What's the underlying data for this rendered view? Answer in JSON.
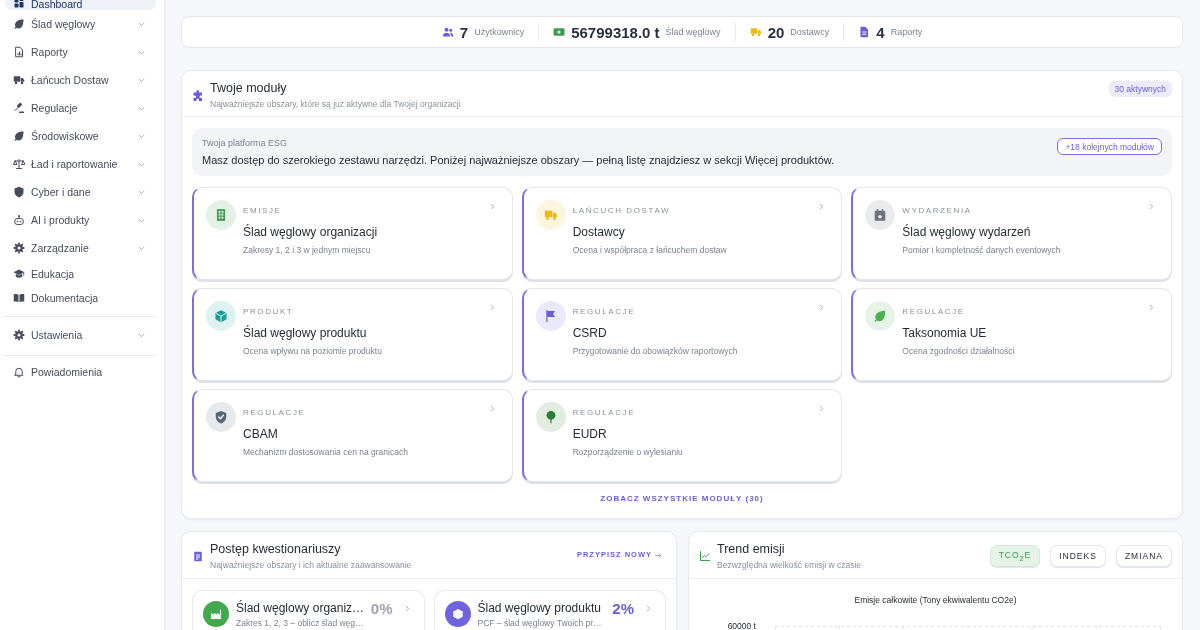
{
  "sidebar": {
    "groups": [
      {
        "items": [
          {
            "label": "Dashboard",
            "selected": true,
            "expandable": false
          },
          {
            "label": "Ślad węglowy",
            "selected": false,
            "expandable": true
          },
          {
            "label": "Raporty",
            "selected": false,
            "expandable": true
          },
          {
            "label": "Łańcuch Dostaw",
            "selected": false,
            "expandable": true
          },
          {
            "label": "Regulacje",
            "selected": false,
            "expandable": true
          },
          {
            "label": "Środowiskowe",
            "selected": false,
            "expandable": true
          },
          {
            "label": "Ład i raportowanie",
            "selected": false,
            "expandable": true
          },
          {
            "label": "Cyber i dane",
            "selected": false,
            "expandable": true
          },
          {
            "label": "AI i produkty",
            "selected": false,
            "expandable": true
          },
          {
            "label": "Zarządzanie",
            "selected": false,
            "expandable": true
          },
          {
            "label": "Edukacja",
            "selected": false,
            "expandable": false
          },
          {
            "label": "Dokumentacja",
            "selected": false,
            "expandable": false
          }
        ]
      },
      {
        "items": [
          {
            "label": "Ustawienia",
            "selected": false,
            "expandable": true
          }
        ]
      },
      {
        "items": [
          {
            "label": "Powiadomienia",
            "selected": false,
            "expandable": false
          }
        ]
      }
    ]
  },
  "stats": [
    {
      "value": "7",
      "label": "Użytkownicy",
      "color": "#6a5fd8"
    },
    {
      "value": "56799318.0 t",
      "label": "Ślad węglowy",
      "color": "#3e9b4f"
    },
    {
      "value": "20",
      "label": "Dostawcy",
      "color": "#f1b814"
    },
    {
      "value": "4",
      "label": "Raporty",
      "color": "#6a5fd8"
    }
  ],
  "modules": {
    "title": "Twoje moduły",
    "subtitle": "Najważniejsze obszary, które są już aktywne dla Twojej organizacji",
    "badge": "30 aktywnych",
    "info": {
      "caption": "Twoja platforma ESG",
      "text": "Masz dostęp do szerokiego zestawu narzędzi. Poniżej najważniejsze obszary — pełną listę znajdziesz w sekcji Więcej produktów.",
      "button": "+18 kolejnych modułów"
    },
    "cards": [
      {
        "category": "EMISJE",
        "title": "Ślad węglowy organizacji",
        "description": "Zakresy 1, 2 i 3 w jednym miejscu",
        "color": "#3e9b4f"
      },
      {
        "category": "ŁAŃCUCH DOSTAW",
        "title": "Dostawcy",
        "description": "Ocena i współpraca z łańcuchem dostaw",
        "color": "#f1b814"
      },
      {
        "category": "WYDARZENIA",
        "title": "Ślad węglowy wydarzeń",
        "description": "Pomiar i kompletność danych eventowych",
        "color": "#6b7280"
      },
      {
        "category": "PRODUKT",
        "title": "Ślad węglowy produktu",
        "description": "Ocena wpływu na poziomie produktu",
        "color": "#1a9e94"
      },
      {
        "category": "REGULACJE",
        "title": "CSRD",
        "description": "Przygotowanie do obowiązków raportowych",
        "color": "#6a5fd8"
      },
      {
        "category": "REGULACJE",
        "title": "Taksonomia UE",
        "description": "Ocena zgodności działalności",
        "color": "#4caf50"
      },
      {
        "category": "REGULACJE",
        "title": "CBAM",
        "description": "Mechanizm dostosowania cen na granicach",
        "color": "#56667a"
      },
      {
        "category": "REGULACJE",
        "title": "EUDR",
        "description": "Rozporządzenie o wylesianiu",
        "color": "#2e7d32"
      }
    ],
    "footer_link": "ZOBACZ WSZYSTKIE MODUŁY (30)"
  },
  "questionnaires": {
    "title": "Postęp kwestionariuszy",
    "subtitle": "Najważniejsze obszary i ich aktualne zaawansowanie",
    "link": "PRZYPISZ NOWY",
    "items": [
      {
        "title": "Ślad węglowy organiz…",
        "description": "Zakres 1, 2, 3 – oblicz ślad węg…",
        "percent": "0%",
        "started": false,
        "color": "#43a94f"
      },
      {
        "title": "Ślad węglowy produktu",
        "description": "PCF – ślad węglowy Twoich pr…",
        "percent": "2%",
        "started": true,
        "color": "#6f63e0"
      }
    ]
  },
  "emissions_trend": {
    "title": "Trend emisji",
    "subtitle": "Bezwzględna wielkość emisji w czasie",
    "toggles": [
      {
        "label": "TCO$_{2}$E",
        "selected": true
      },
      {
        "label": "INDEKS",
        "selected": false
      },
      {
        "label": "ZMIANA",
        "selected": false
      }
    ],
    "chart": {
      "title": "Emisje całkowite (Tony ekwiwalentu CO2e)",
      "axis_labels": [
        "60000 t"
      ]
    }
  }
}
